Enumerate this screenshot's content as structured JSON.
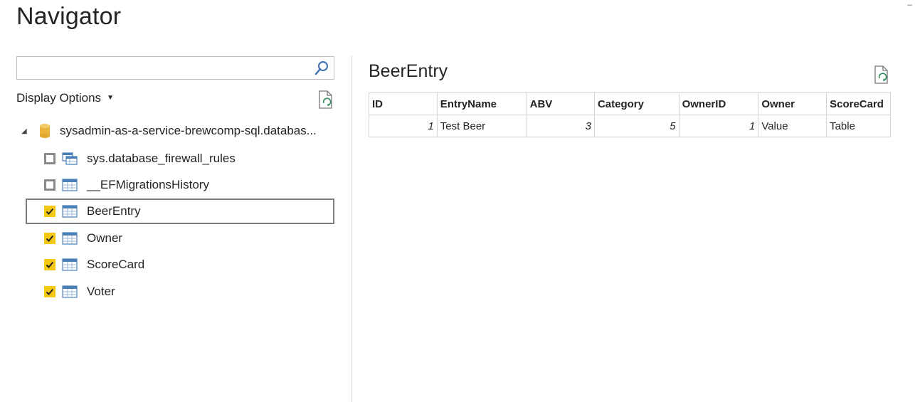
{
  "window": {
    "title": "Navigator",
    "controls": [
      "_",
      " "
    ]
  },
  "search": {
    "value": "",
    "placeholder": ""
  },
  "display_options": {
    "label": "Display Options"
  },
  "tree": {
    "database": {
      "label": "sysadmin-as-a-service-brewcomp-sql.databas..."
    },
    "items": [
      {
        "label": "sys.database_firewall_rules",
        "checked": false,
        "icon": "view-icon",
        "selected": false
      },
      {
        "label": "__EFMigrationsHistory",
        "checked": false,
        "icon": "table-icon",
        "selected": false
      },
      {
        "label": "BeerEntry",
        "checked": true,
        "icon": "table-icon",
        "selected": true
      },
      {
        "label": "Owner",
        "checked": true,
        "icon": "table-icon",
        "selected": false
      },
      {
        "label": "ScoreCard",
        "checked": true,
        "icon": "table-icon",
        "selected": false
      },
      {
        "label": "Voter",
        "checked": true,
        "icon": "table-icon",
        "selected": false
      }
    ]
  },
  "preview": {
    "title": "BeerEntry",
    "columns": [
      "ID",
      "EntryName",
      "ABV",
      "Category",
      "OwnerID",
      "Owner",
      "ScoreCard"
    ],
    "rows": [
      [
        "1",
        "Test Beer",
        "3",
        "5",
        "1",
        "Value",
        "Table"
      ]
    ]
  },
  "colors": {
    "checked": "#f2c811",
    "icon_blue": "#4a7fb8",
    "db_icon": "#e8b53a"
  }
}
